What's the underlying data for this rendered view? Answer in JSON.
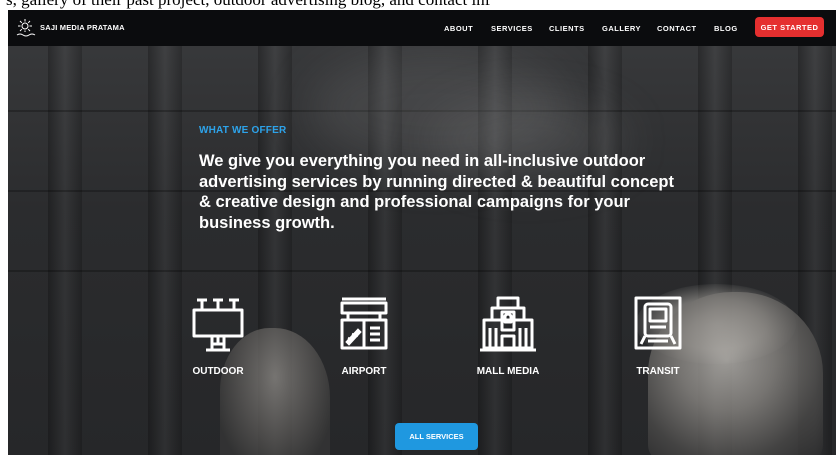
{
  "caption": "s, gallery of their past project, outdoor advertising blog, and contact inf",
  "nav": {
    "brand": "SAJI MEDIA PRATAMA",
    "items": [
      {
        "label": "ABOUT"
      },
      {
        "label": "SERVICES"
      },
      {
        "label": "CLIENTS"
      },
      {
        "label": "GALLERY"
      },
      {
        "label": "CONTACT"
      },
      {
        "label": "BLOG"
      }
    ],
    "cta_label": "GET STARTED"
  },
  "hero": {
    "eyebrow": "WHAT WE OFFER",
    "headline": "We give you everything you need in all-inclusive outdoor advertising services by running directed & beautiful concept & creative design and professional campaigns for your business growth."
  },
  "services": [
    {
      "label": "OUTDOOR",
      "icon": "billboard-icon"
    },
    {
      "label": "AIRPORT",
      "icon": "airport-icon"
    },
    {
      "label": "MALL MEDIA",
      "icon": "mall-icon"
    },
    {
      "label": "TRANSIT",
      "icon": "transit-icon"
    }
  ],
  "all_services_label": "ALL SERVICES",
  "colors": {
    "nav_bg": "#0b0c0e",
    "cta": "#e52f2f",
    "accent_blue": "#2da3ea",
    "button_blue": "#1f98e0"
  }
}
